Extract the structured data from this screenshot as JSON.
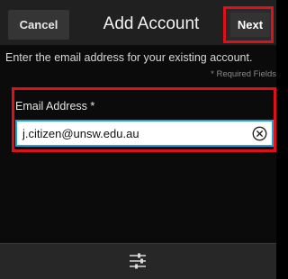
{
  "titlebar": {
    "cancel_label": "Cancel",
    "title": "Add Account",
    "next_label": "Next"
  },
  "form": {
    "description": "Enter the email address for your existing account.",
    "required_note": "* Required Fields",
    "email_label": "Email Address *",
    "email_value": "j.citizen@unsw.edu.au"
  },
  "icons": {
    "clear": "clear-icon",
    "settings": "settings-sliders-icon"
  },
  "colors": {
    "highlight": "#e0101a",
    "input_focus": "#1fa3d6"
  }
}
